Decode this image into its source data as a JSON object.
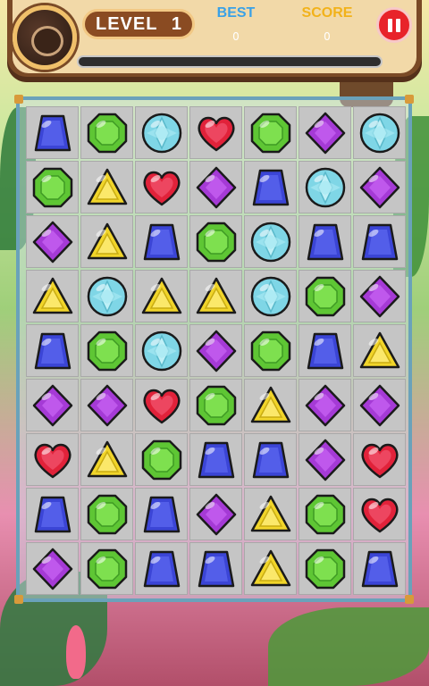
{
  "hud": {
    "level_label": "LEVEL",
    "level_value": "1",
    "best_label": "BEST",
    "best_value": "0",
    "score_label": "SCORE",
    "score_value": "0",
    "progress_fraction": 0
  },
  "colors": {
    "blue": "#3b45d6",
    "green": "#5ec634",
    "cyan": "#7fd6e6",
    "red": "#e1223a",
    "purple": "#a53ad6",
    "yellow": "#f1d52a",
    "pause": "#e8232a"
  },
  "board": {
    "rows": [
      [
        "blue-trapezoid-gem",
        "green-octagon-gem",
        "cyan-round-gem",
        "red-heart-gem",
        "green-octagon-gem",
        "purple-diamond-gem",
        "cyan-round-gem"
      ],
      [
        "green-octagon-gem",
        "yellow-triangle-gem",
        "red-heart-gem",
        "purple-diamond-gem",
        "blue-trapezoid-gem",
        "cyan-round-gem",
        "purple-diamond-gem"
      ],
      [
        "purple-diamond-gem",
        "yellow-triangle-gem",
        "blue-trapezoid-gem",
        "green-octagon-gem",
        "cyan-round-gem",
        "blue-trapezoid-gem",
        "blue-trapezoid-gem"
      ],
      [
        "yellow-triangle-gem",
        "cyan-round-gem",
        "yellow-triangle-gem",
        "yellow-triangle-gem",
        "cyan-round-gem",
        "green-octagon-gem",
        "purple-diamond-gem"
      ],
      [
        "blue-trapezoid-gem",
        "green-octagon-gem",
        "cyan-round-gem",
        "purple-diamond-gem",
        "green-octagon-gem",
        "blue-trapezoid-gem",
        "yellow-triangle-gem"
      ],
      [
        "purple-diamond-gem",
        "purple-diamond-gem",
        "red-heart-gem",
        "green-octagon-gem",
        "yellow-triangle-gem",
        "purple-diamond-gem",
        "purple-diamond-gem"
      ],
      [
        "red-heart-gem",
        "yellow-triangle-gem",
        "green-octagon-gem",
        "blue-trapezoid-gem",
        "blue-trapezoid-gem",
        "purple-diamond-gem",
        "red-heart-gem"
      ],
      [
        "blue-trapezoid-gem",
        "green-octagon-gem",
        "blue-trapezoid-gem",
        "purple-diamond-gem",
        "yellow-triangle-gem",
        "green-octagon-gem",
        "red-heart-gem"
      ],
      [
        "purple-diamond-gem",
        "green-octagon-gem",
        "blue-trapezoid-gem",
        "blue-trapezoid-gem",
        "yellow-triangle-gem",
        "green-octagon-gem",
        "blue-trapezoid-gem"
      ]
    ]
  }
}
